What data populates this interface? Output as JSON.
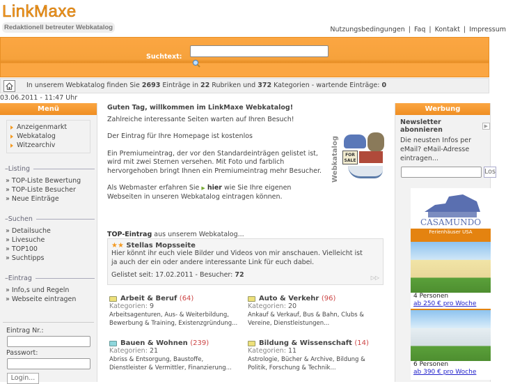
{
  "header": {
    "logo": "LinkMaxe",
    "tagline": "Redaktionell betreuter Webkatalog",
    "links": [
      "Nutzungsbedingungen",
      "Faq",
      "Kontakt",
      "Impressum"
    ]
  },
  "search": {
    "label": "Suchtext:",
    "value": ""
  },
  "stats": {
    "pre": "In unserem Webkatalog finden Sie ",
    "entries": "2693",
    "mid1": " Einträge in ",
    "rubrics": "22",
    "mid2": " Rubriken und ",
    "categories": "372",
    "mid3": " Kategorien - wartende Einträge: ",
    "waiting": "0"
  },
  "date": "03.06.2011 - 11:47 Uhr",
  "left": {
    "title": "Menü",
    "menu": [
      "Anzeigenmarkt",
      "Webkatalog",
      "Witzearchiv"
    ],
    "sections": [
      {
        "title": "Listing",
        "items": [
          "» TOP-Liste Bewertung",
          "» TOP-Liste Besucher",
          "» Neue Einträge"
        ]
      },
      {
        "title": "Suchen",
        "items": [
          "» Detailsuche",
          "» Livesuche",
          "» TOP100",
          "» Suchtipps"
        ]
      },
      {
        "title": "Eintrag",
        "items": [
          "» Info,s und Regeln",
          "» Webseite eintragen"
        ]
      }
    ],
    "login": {
      "nr_label": "Eintrag Nr.:",
      "pw_label": "Passwort:",
      "button": "Login..."
    }
  },
  "main": {
    "welcome": "Guten Tag, willkommen im LinkMaxe Webkatalog!",
    "p1": "Zahlreiche interessante Seiten warten auf Ihren Besuch!",
    "p2": "Der Eintrag für Ihre Homepage ist kostenlos",
    "p3": "Ein Premiumeintrag, der vor den Standardeinträgen gelistet ist, wird mit zwei Sternen versehen. Mit Foto und farblich hervorgehoben bringt Ihnen ein Premiumeintrag mehr Besucher.",
    "p4a": "Als Webmaster erfahren Sie ",
    "p4link": "hier",
    "p4b": " wie Sie Ihre eigenen Webseiten in unseren Webkatalog eintragen können.",
    "promo_label": "Webkatalog",
    "promo_sign": "FOR SALE",
    "top": {
      "label": "TOP-Eintrag",
      "label_rest": " aus unserem Webkatalog...",
      "stars": "★★",
      "title": "Stellas Mopsseite",
      "desc": "Hier könnt ihr euch viele Bilder und Videos von mir anschauen. Vielleicht ist ja auch der ein oder andere interessante Link für euch dabei.",
      "since": "Gelistet seit: 17.02.2011 - Besucher: ",
      "visitors": "72"
    },
    "categories": [
      {
        "name": "Arbeit & Beruf",
        "count": "(64)",
        "kat_label": "Kategorien: ",
        "kat": "9",
        "desc": "Arbeitsagenturen, Aus- & Weiterbildung, Bewerbung & Training, Existenzgründung..."
      },
      {
        "name": "Auto & Verkehr",
        "count": "(96)",
        "kat_label": "Kategorien: ",
        "kat": "20",
        "desc": "Ankauf & Verkauf, Bus & Bahn, Clubs & Vereine, Dienstleistungen..."
      },
      {
        "name": "Bauen & Wohnen",
        "count": "(239)",
        "kat_label": "Kategorien: ",
        "kat": "21",
        "desc": "Abriss & Entsorgung, Baustoffe, Dienstleister & Vermittler, Finanzierung..."
      },
      {
        "name": "Bildung & Wissenschaft",
        "count": "(14)",
        "kat_label": "Kategorien: ",
        "kat": "11",
        "desc": "Astrologie, Bücher & Archive, Bildung & Politik, Forschung & Technik..."
      }
    ]
  },
  "right": {
    "title": "Werbung",
    "newsletter": "Newsletter abonnieren",
    "nl_text": "Die neusten Infos per eMail? eMail-Adresse eintragen...",
    "button": "Los",
    "ad": {
      "brand": "CASAMUNDO",
      "banner": "Ferienhäuser USA",
      "offers": [
        {
          "persons": "4 Personen",
          "price": "ab 250 € pro Woche"
        },
        {
          "persons": "6 Personen",
          "price": "ab 390 € pro Woche"
        }
      ]
    }
  },
  "colors": {
    "accent": "#f6a23c",
    "link": "#2222cc",
    "count": "#cc4444"
  }
}
